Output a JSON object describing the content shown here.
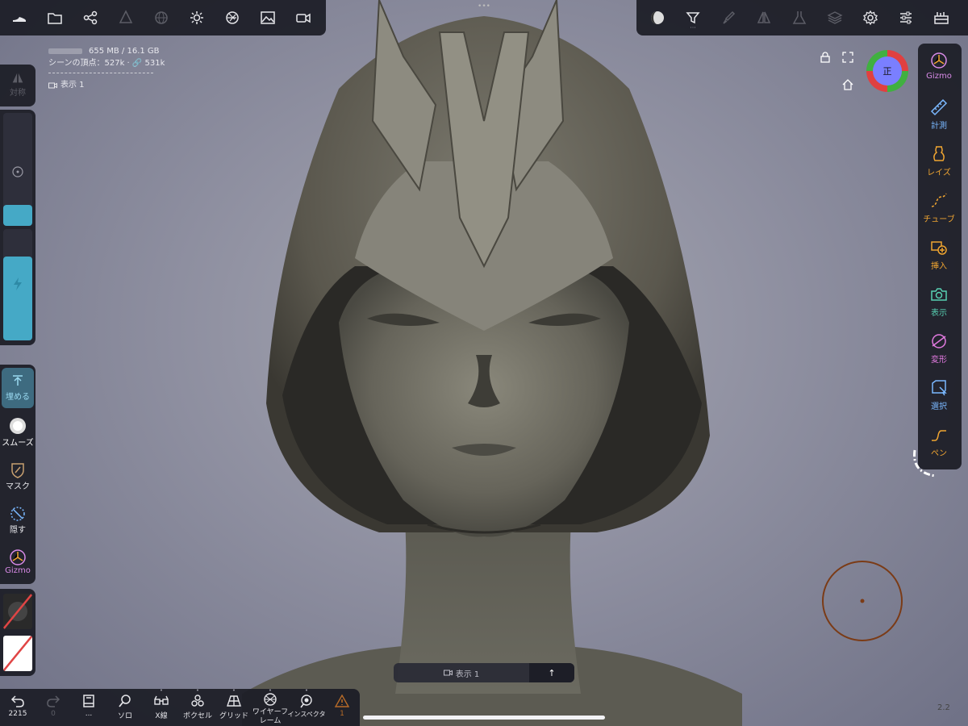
{
  "top_toolbar_left": [
    {
      "icon": "shoe-icon"
    },
    {
      "icon": "folder-icon"
    },
    {
      "icon": "share-nodes-icon"
    },
    {
      "icon": "material-cone-icon"
    },
    {
      "icon": "sphere-grid-icon"
    },
    {
      "icon": "sun-icon"
    },
    {
      "icon": "aperture-icon"
    },
    {
      "icon": "image-icon"
    },
    {
      "icon": "camera-video-icon"
    }
  ],
  "top_toolbar_right": [
    {
      "icon": "moon-shading-icon"
    },
    {
      "icon": "filter-icon"
    },
    {
      "icon": "brush-icon"
    },
    {
      "icon": "symmetry-icon"
    },
    {
      "icon": "flask-icon"
    },
    {
      "icon": "layers-icon"
    },
    {
      "icon": "gear-icon"
    },
    {
      "icon": "sliders-icon"
    },
    {
      "icon": "toolbox-icon"
    }
  ],
  "stats": {
    "memory": "655 MB / 16.1 GB",
    "vertices": "シーンの頂点：527k · 🔗 531k",
    "camera": "表示 1"
  },
  "left_panel": {
    "symmetry_label": "対称",
    "bury_label": "埋める",
    "smooth_label": "スムーズ",
    "mask_label": "マスク",
    "hide_label": "隠す",
    "gizmo_label": "Gizmo"
  },
  "right_panel": {
    "items": [
      {
        "label": "Gizmo",
        "color": "#d98be8"
      },
      {
        "label": "計測",
        "color": "#7ab8ff"
      },
      {
        "label": "レイズ",
        "color": "#f0a531"
      },
      {
        "label": "チューブ",
        "color": "#f0a531"
      },
      {
        "label": "挿入",
        "color": "#f0a531"
      },
      {
        "label": "表示",
        "color": "#58d0b2"
      },
      {
        "label": "変形",
        "color": "#e27ae0"
      },
      {
        "label": "選択",
        "color": "#7ab8ff"
      },
      {
        "label": "ペン",
        "color": "#f0a531"
      }
    ]
  },
  "view_cube_label": "正",
  "bottom_toolbar": [
    {
      "label": "2215",
      "icon": "undo-icon"
    },
    {
      "label": "0",
      "icon": "redo-icon"
    },
    {
      "label": "...",
      "icon": "book-icon"
    },
    {
      "label": "ソロ",
      "icon": "magnifier-icon"
    },
    {
      "label": "X線",
      "icon": "glasses-icon"
    },
    {
      "label": "ボクセル",
      "icon": "voxel-icon"
    },
    {
      "label": "グリッド",
      "icon": "grid-plane-icon"
    },
    {
      "label": "ワイヤーフ\nレーム",
      "icon": "wireframe-icon"
    },
    {
      "label": "インスペクタ",
      "icon": "inspect-icon"
    },
    {
      "label": "1",
      "icon": "warning-icon"
    }
  ],
  "bottom_camera": {
    "label": "表示 1",
    "arrow": "↑"
  },
  "version": "2.2"
}
